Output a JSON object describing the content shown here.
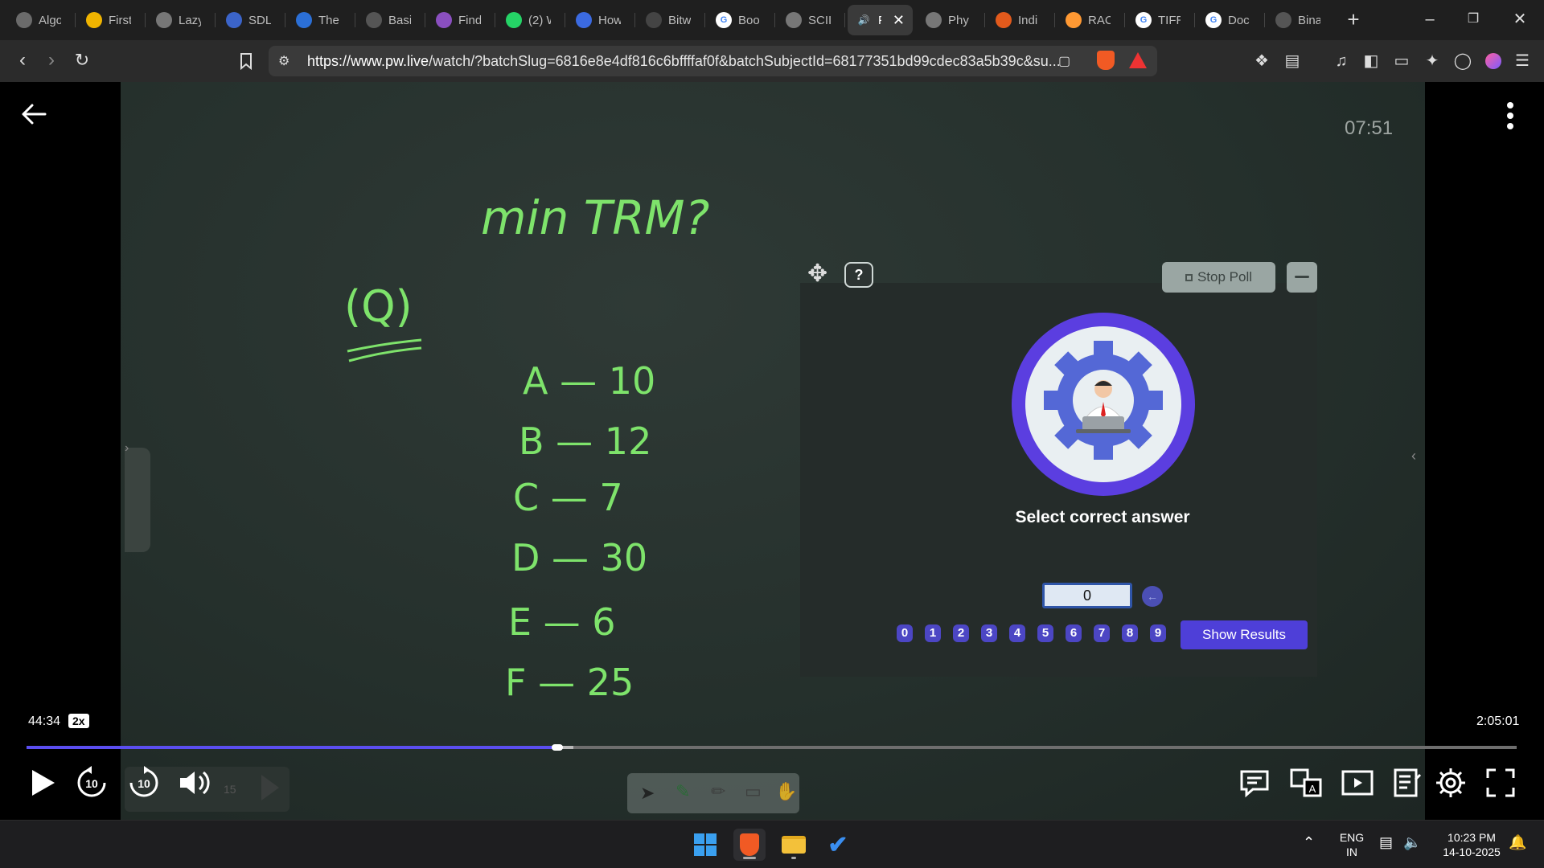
{
  "browser": {
    "tabs": [
      {
        "label": "Algo",
        "icon": "chatgpt-icon"
      },
      {
        "label": "First",
        "icon": "lightning-icon"
      },
      {
        "label": "Lazy",
        "icon": "globe-icon"
      },
      {
        "label": "SDL",
        "icon": "stacks-icon"
      },
      {
        "label": "The",
        "icon": "wave-icon"
      },
      {
        "label": "Basi",
        "icon": "card-icon"
      },
      {
        "label": "Find",
        "icon": "mushroom-icon"
      },
      {
        "label": "(2) W",
        "icon": "whatsapp-icon"
      },
      {
        "label": "How",
        "icon": "bookmark-icon"
      },
      {
        "label": "Bitw",
        "icon": "bit-icon"
      },
      {
        "label": "Boo",
        "icon": "google-icon"
      },
      {
        "label": "SCII",
        "icon": "globe-icon"
      },
      {
        "label": "P",
        "icon": "speaker-icon",
        "active": true
      },
      {
        "label": "Phy",
        "icon": "wiki-icon"
      },
      {
        "label": "Indi",
        "icon": "ball-icon"
      },
      {
        "label": "RAC",
        "icon": "flag-india-icon"
      },
      {
        "label": "TIFR",
        "icon": "google-icon"
      },
      {
        "label": "Doc",
        "icon": "google-icon"
      },
      {
        "label": "Bina",
        "icon": "openai-icon"
      }
    ],
    "url_domain": "https://www.pw.live",
    "url_rest": "/watch/?batchSlug=6816e8e4df816c6bffffaf0f&batchSubjectId=68177351bd99cdec83a5b39c&su..."
  },
  "player": {
    "top_timestamp": "07:51",
    "board": {
      "title": "min TRM?",
      "q_label": "(Q)",
      "items": [
        "A — 10",
        "B — 12",
        "C — 7",
        "D — 30",
        "E — 6",
        "F — 25"
      ]
    },
    "poll": {
      "stop_label": "Stop Poll",
      "help_label": "?",
      "prompt": "Select correct answer",
      "answer_value": "0",
      "digits": [
        "0",
        "1",
        "2",
        "3",
        "4",
        "5",
        "6",
        "7",
        "8",
        "9"
      ],
      "show_results_label": "Show Results"
    },
    "current_time": "44:34",
    "speed": "2x",
    "duration": "2:05:01",
    "progress_fraction": 0.356,
    "buffer_fraction": 0.367,
    "skip_back_label": "10",
    "skip_fwd_label": "10",
    "board_tool_label": "15"
  },
  "taskbar": {
    "lang_top": "ENG",
    "lang_bottom": "IN",
    "time": "10:23 PM",
    "date": "14-10-2025"
  }
}
